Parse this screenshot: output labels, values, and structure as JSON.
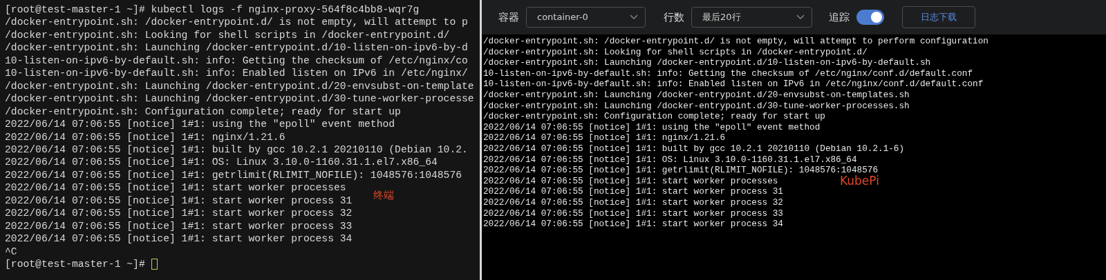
{
  "terminal": {
    "lines": [
      "[root@test-master-1 ~]# kubectl logs -f nginx-proxy-564f8c4bb8-wqr7g",
      "/docker-entrypoint.sh: /docker-entrypoint.d/ is not empty, will attempt to p",
      "/docker-entrypoint.sh: Looking for shell scripts in /docker-entrypoint.d/",
      "/docker-entrypoint.sh: Launching /docker-entrypoint.d/10-listen-on-ipv6-by-d",
      "10-listen-on-ipv6-by-default.sh: info: Getting the checksum of /etc/nginx/co",
      "10-listen-on-ipv6-by-default.sh: info: Enabled listen on IPv6 in /etc/nginx/",
      "/docker-entrypoint.sh: Launching /docker-entrypoint.d/20-envsubst-on-template",
      "/docker-entrypoint.sh: Launching /docker-entrypoint.d/30-tune-worker-processe",
      "/docker-entrypoint.sh: Configuration complete; ready for start up",
      "2022/06/14 07:06:55 [notice] 1#1: using the \"epoll\" event method",
      "2022/06/14 07:06:55 [notice] 1#1: nginx/1.21.6",
      "2022/06/14 07:06:55 [notice] 1#1: built by gcc 10.2.1 20210110 (Debian 10.2.",
      "2022/06/14 07:06:55 [notice] 1#1: OS: Linux 3.10.0-1160.31.1.el7.x86_64",
      "2022/06/14 07:06:55 [notice] 1#1: getrlimit(RLIMIT_NOFILE): 1048576:1048576",
      "2022/06/14 07:06:55 [notice] 1#1: start worker processes",
      "2022/06/14 07:06:55 [notice] 1#1: start worker process 31",
      "2022/06/14 07:06:55 [notice] 1#1: start worker process 32",
      "2022/06/14 07:06:55 [notice] 1#1: start worker process 33",
      "2022/06/14 07:06:55 [notice] 1#1: start worker process 34",
      "^C"
    ],
    "prompt": "[root@test-master-1 ~]#",
    "caption": "终端"
  },
  "kubepi": {
    "container": {
      "label": "容器",
      "value": "container-0"
    },
    "line_count": {
      "label": "行数",
      "value": "最后20行"
    },
    "follow": {
      "label": "追踪",
      "on": true
    },
    "download_button": "日志下载",
    "log_lines": [
      "/docker-entrypoint.sh: /docker-entrypoint.d/ is not empty, will attempt to perform configuration",
      "/docker-entrypoint.sh: Looking for shell scripts in /docker-entrypoint.d/",
      "/docker-entrypoint.sh: Launching /docker-entrypoint.d/10-listen-on-ipv6-by-default.sh",
      "10-listen-on-ipv6-by-default.sh: info: Getting the checksum of /etc/nginx/conf.d/default.conf",
      "10-listen-on-ipv6-by-default.sh: info: Enabled listen on IPv6 in /etc/nginx/conf.d/default.conf",
      "/docker-entrypoint.sh: Launching /docker-entrypoint.d/20-envsubst-on-templates.sh",
      "/docker-entrypoint.sh: Launching /docker-entrypoint.d/30-tune-worker-processes.sh",
      "/docker-entrypoint.sh: Configuration complete; ready for start up",
      "2022/06/14 07:06:55 [notice] 1#1: using the \"epoll\" event method",
      "2022/06/14 07:06:55 [notice] 1#1: nginx/1.21.6",
      "2022/06/14 07:06:55 [notice] 1#1: built by gcc 10.2.1 20210110 (Debian 10.2.1-6)",
      "2022/06/14 07:06:55 [notice] 1#1: OS: Linux 3.10.0-1160.31.1.el7.x86_64",
      "2022/06/14 07:06:55 [notice] 1#1: getrlimit(RLIMIT_NOFILE): 1048576:1048576",
      "2022/06/14 07:06:55 [notice] 1#1: start worker processes",
      "2022/06/14 07:06:55 [notice] 1#1: start worker process 31",
      "2022/06/14 07:06:55 [notice] 1#1: start worker process 32",
      "2022/06/14 07:06:55 [notice] 1#1: start worker process 33",
      "2022/06/14 07:06:55 [notice] 1#1: start worker process 34"
    ],
    "caption": "KubePi"
  }
}
